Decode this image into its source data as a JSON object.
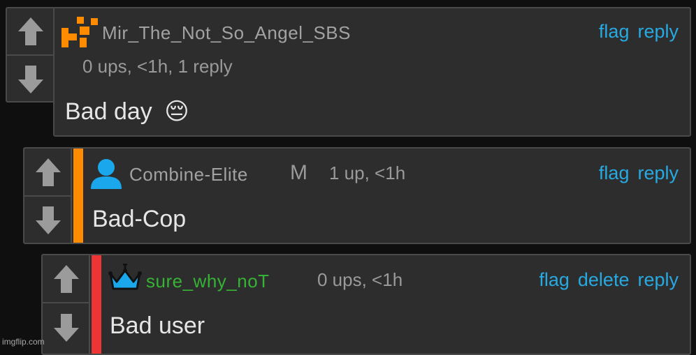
{
  "comments": [
    {
      "username": "Mir_The_Not_So_Angel_SBS",
      "username_color": "#a2a2a2",
      "avatar": "pixel-icon",
      "meta": "0 ups, <1h, 1 reply",
      "body": "Bad day",
      "emoji": "😔",
      "actions": {
        "flag": "flag",
        "reply": "reply"
      }
    },
    {
      "username": "Combine-Elite",
      "username_color": "#a2a2a2",
      "avatar": "user-icon",
      "badge": "M",
      "meta": "1 up, <1h",
      "body": "Bad-Cop",
      "thread_color": "#ff8c00",
      "actions": {
        "flag": "flag",
        "reply": "reply"
      }
    },
    {
      "username": "sure_why_noT",
      "username_color": "#36b334",
      "avatar": "crown-icon",
      "meta": "0 ups, <1h",
      "body": "Bad user",
      "thread_color": "#ee3434",
      "actions": {
        "flag": "flag",
        "delete": "delete",
        "reply": "reply"
      }
    }
  ],
  "colors": {
    "background": "#0f0f10",
    "card": "#2d2d2e",
    "border": "#4a4a4b",
    "link": "#27a9e1",
    "arrow": "#9b9b9b"
  },
  "watermark": "imgflip.com"
}
